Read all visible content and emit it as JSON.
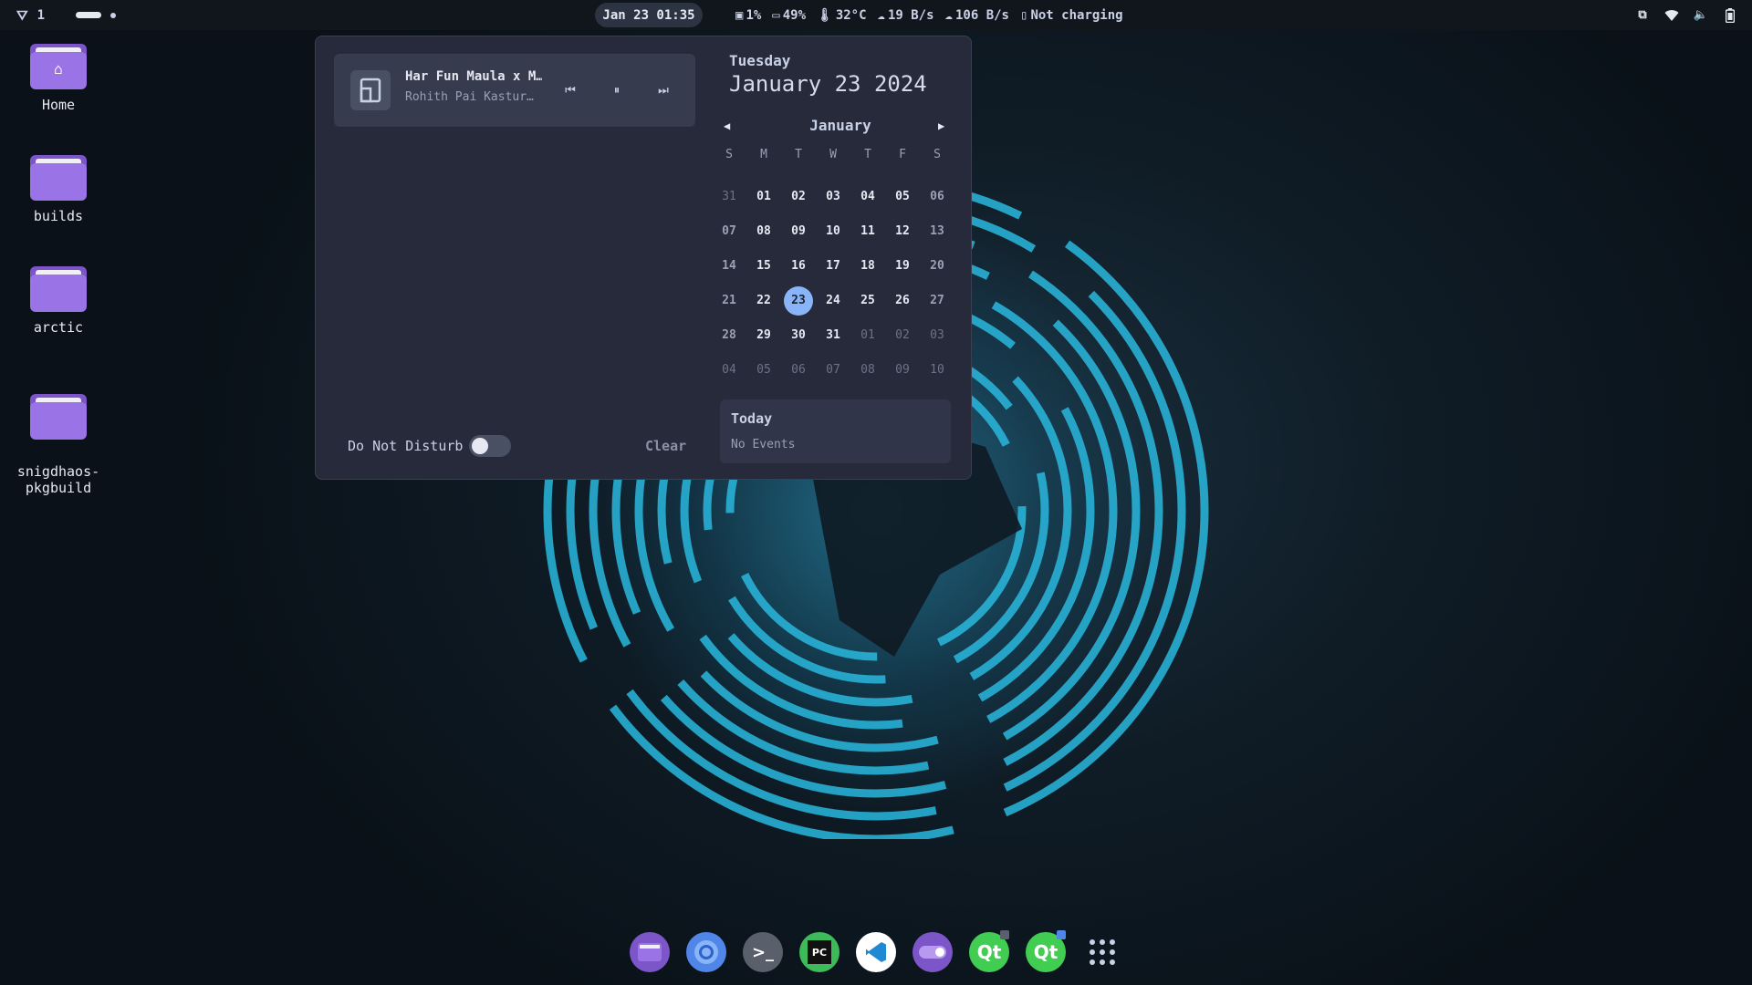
{
  "topbar": {
    "workspace_number": "1",
    "clock": "Jan 23 01:35",
    "stats": [
      {
        "icon": "disk-icon",
        "text": "1%"
      },
      {
        "icon": "memory-icon",
        "text": "49%"
      },
      {
        "icon": "temperature-icon",
        "text": "32°C"
      },
      {
        "icon": "download-icon",
        "text": "19 B/s"
      },
      {
        "icon": "upload-icon",
        "text": "106 B/s"
      },
      {
        "icon": "battery-icon",
        "text": "Not charging"
      }
    ],
    "tray_icons": [
      "media-tray-icon",
      "wifi-icon",
      "volume-icon",
      "battery-tray-icon"
    ]
  },
  "desktop": {
    "icons": [
      {
        "label": "Home",
        "icon": "home-folder-icon"
      },
      {
        "label": "builds",
        "icon": "folder-icon"
      },
      {
        "label": "arctic",
        "icon": "folder-icon"
      },
      {
        "label": "snigdhaos-\npkgbuild",
        "icon": "folder-icon"
      }
    ]
  },
  "panel": {
    "media": {
      "title": "Har Fun Maula x M…",
      "artist": "Rohith Pai Kastur…",
      "prev_icon": "previous-icon",
      "pause_icon": "pause-icon",
      "next_icon": "next-icon"
    },
    "dnd_label": "Do Not Disturb",
    "dnd_enabled": false,
    "clear_label": "Clear",
    "calendar": {
      "weekday": "Tuesday",
      "full_date": "January 23 2024",
      "month": "January",
      "headers": [
        "S",
        "M",
        "T",
        "W",
        "T",
        "F",
        "S"
      ],
      "weeks": [
        [
          "31",
          "01",
          "02",
          "03",
          "04",
          "05",
          "06"
        ],
        [
          "07",
          "08",
          "09",
          "10",
          "11",
          "12",
          "13"
        ],
        [
          "14",
          "15",
          "16",
          "17",
          "18",
          "19",
          "20"
        ],
        [
          "21",
          "22",
          "23",
          "24",
          "25",
          "26",
          "27"
        ],
        [
          "28",
          "29",
          "30",
          "31",
          "01",
          "02",
          "03"
        ],
        [
          "04",
          "05",
          "06",
          "07",
          "08",
          "09",
          "10"
        ]
      ],
      "today": "23",
      "events_title": "Today",
      "events_empty": "No Events"
    }
  },
  "dock": {
    "apps": [
      {
        "name": "files",
        "icon": "files-icon",
        "color": "#7c55c9"
      },
      {
        "name": "chromium",
        "icon": "chromium-icon",
        "color": "#4f86e8"
      },
      {
        "name": "terminal",
        "icon": "terminal-icon",
        "color": "#5a5f6c"
      },
      {
        "name": "pycharm",
        "icon": "pycharm-icon",
        "color": "#3dbb5a"
      },
      {
        "name": "vscode",
        "icon": "vscode-icon",
        "color": "#ffffff"
      },
      {
        "name": "toggle-app",
        "icon": "toggle-app-icon",
        "color": "#7c55c9"
      },
      {
        "name": "qt-creator",
        "icon": "qt-icon",
        "color": "#41cd52"
      },
      {
        "name": "qt-designer",
        "icon": "qt-designer-icon",
        "color": "#41cd52"
      },
      {
        "name": "app-grid",
        "icon": "app-grid-icon",
        "color": "transparent"
      }
    ]
  }
}
